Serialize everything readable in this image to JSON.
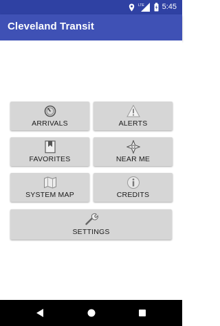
{
  "status_bar": {
    "time": "5:45",
    "network_label": "LTE",
    "icons": [
      "location-icon",
      "signal-icon",
      "battery-icon"
    ],
    "color": "#2f41a3"
  },
  "app_bar": {
    "title": "Cleveland Transit",
    "color": "#3f51b5"
  },
  "menu": {
    "arrivals": {
      "label": "ARRIVALS",
      "icon": "clock-icon"
    },
    "alerts": {
      "label": "ALERTS",
      "icon": "warning-icon"
    },
    "favorites": {
      "label": "FAVORITES",
      "icon": "bookmark-icon"
    },
    "near_me": {
      "label": "NEAR ME",
      "icon": "compass-icon"
    },
    "system_map": {
      "label": "SYSTEM MAP",
      "icon": "map-icon"
    },
    "credits": {
      "label": "CREDITS",
      "icon": "info-icon"
    },
    "settings": {
      "label": "SETTINGS",
      "icon": "wrench-icon"
    },
    "button_color": "#d6d6d6"
  },
  "nav_bar": {
    "icons": [
      "back-icon",
      "home-icon",
      "recents-icon"
    ]
  }
}
